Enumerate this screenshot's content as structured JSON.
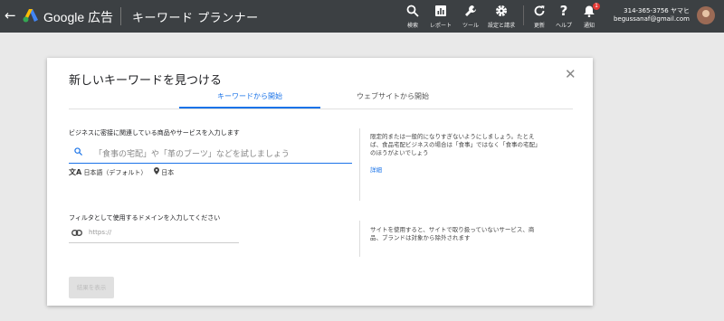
{
  "header": {
    "back_icon": "arrow-left-icon",
    "brand": "Google 広告",
    "page_title": "キーワード プランナー",
    "tools": [
      {
        "label": "検索",
        "icon": "search-icon"
      },
      {
        "label": "レポート",
        "icon": "reports-icon"
      },
      {
        "label": "ツール",
        "icon": "wrench-icon"
      },
      {
        "label": "設定と請求",
        "icon": "gear-icon"
      },
      {
        "label": "更新",
        "icon": "refresh-icon"
      },
      {
        "label": "ヘルプ",
        "icon": "help-icon"
      },
      {
        "label": "通知",
        "icon": "bell-icon"
      }
    ],
    "notification_count": "1",
    "account_id": "314-365-3756 ヤマヒ",
    "account_email": "begussanaf@gmail.com"
  },
  "dialog": {
    "title": "新しいキーワードを見つける",
    "tabs": [
      "キーワードから開始",
      "ウェブサイトから開始"
    ],
    "active_tab": 0,
    "keyword_section": {
      "label": "ビジネスに密接に関連している商品やサービスを入力します",
      "placeholder": "「食事の宅配」や「革のブーツ」などを試しましょう",
      "language": "日本語（デフォルト）",
      "location": "日本",
      "help_line1": "限定的または一般的になりすぎないようにしましょう。たとえ",
      "help_line2": "ば、食品宅配ビジネスの場合は「食事」ではなく「食事の宅配」",
      "help_line3": "のほうがよいでしょう",
      "help_link": "詳細"
    },
    "domain_section": {
      "label": "フィルタとして使用するドメインを入力してください",
      "placeholder": "https://",
      "help_line1": "サイトを使用すると、サイトで取り扱っていないサービス、商",
      "help_line2": "品、ブランドは対象から除外されます"
    },
    "submit_label": "結果を表示"
  },
  "colors": {
    "header_bg": "#3c4043",
    "accent": "#1a73e8",
    "page_bg": "#e9e9e9"
  }
}
